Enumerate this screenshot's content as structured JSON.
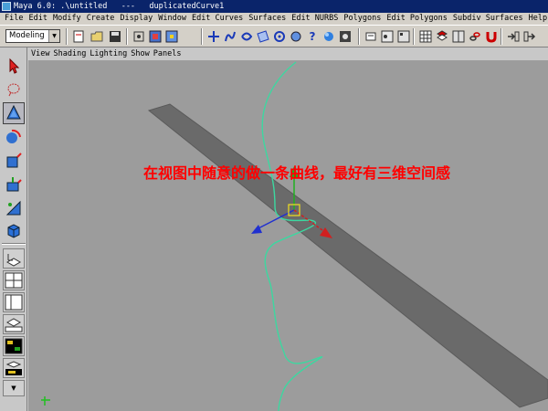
{
  "window": {
    "title": "Maya 6.0: .\\untitled   ---   duplicatedCurve1"
  },
  "menubar": {
    "items": [
      "File",
      "Edit",
      "Modify",
      "Create",
      "Display",
      "Window",
      "Edit Curves",
      "Surfaces",
      "Edit NURBS",
      "Polygons",
      "Edit Polygons",
      "Subdiv Surfaces",
      "Help"
    ]
  },
  "toolbar": {
    "mode": "Modeling"
  },
  "panel": {
    "menu": [
      "View",
      "Shading",
      "Lighting",
      "Show",
      "Panels"
    ]
  },
  "viewport": {
    "annotation": "在视图中随意的做一条曲线，最好有三维空间感"
  },
  "colors": {
    "curve": "#3cd8a0",
    "plane": "#6a6a6a",
    "annotation": "#ff0000",
    "x_axis": "#d02020",
    "y_axis": "#20b020",
    "z_axis": "#2030d0",
    "pivot": "#f0e020"
  }
}
